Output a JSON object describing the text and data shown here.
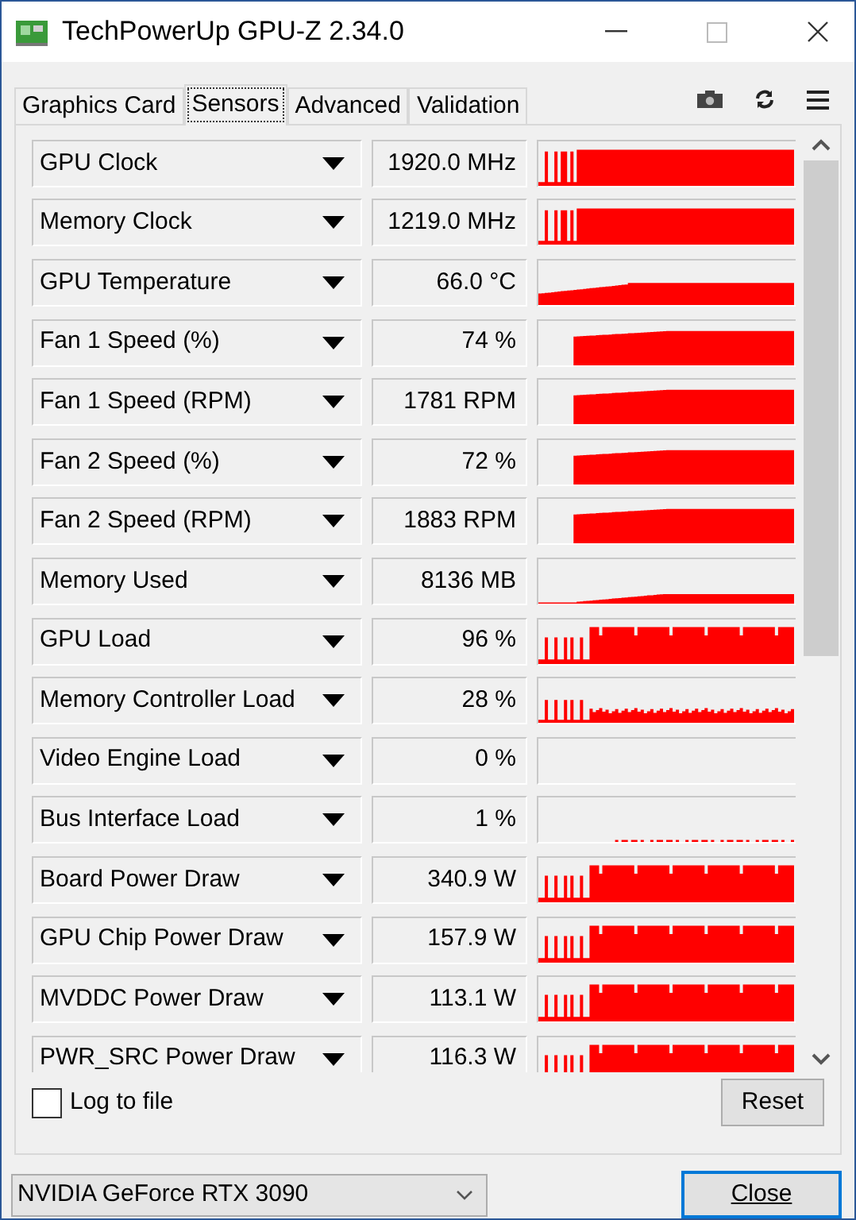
{
  "window": {
    "title": "TechPowerUp GPU-Z 2.34.0"
  },
  "tabs": [
    {
      "label": "Graphics Card",
      "selected": false
    },
    {
      "label": "Sensors",
      "selected": true
    },
    {
      "label": "Advanced",
      "selected": false
    },
    {
      "label": "Validation",
      "selected": false
    }
  ],
  "sensors": [
    {
      "name": "GPU Clock",
      "value": "1920.0 MHz",
      "kind": "spiky"
    },
    {
      "name": "Memory Clock",
      "value": "1219.0 MHz",
      "kind": "spiky"
    },
    {
      "name": "GPU Temperature",
      "value": "66.0 °C",
      "kind": "rise"
    },
    {
      "name": "Fan 1 Speed (%)",
      "value": "74 %",
      "kind": "ramp"
    },
    {
      "name": "Fan 1 Speed (RPM)",
      "value": "1781 RPM",
      "kind": "ramp"
    },
    {
      "name": "Fan 2 Speed (%)",
      "value": "72 %",
      "kind": "ramp"
    },
    {
      "name": "Fan 2 Speed (RPM)",
      "value": "1883 RPM",
      "kind": "ramp"
    },
    {
      "name": "Memory Used",
      "value": "8136 MB",
      "kind": "low"
    },
    {
      "name": "GPU Load",
      "value": "96 %",
      "kind": "load"
    },
    {
      "name": "Memory Controller Load",
      "value": "28 %",
      "kind": "lowload"
    },
    {
      "name": "Video Engine Load",
      "value": "0 %",
      "kind": "flat"
    },
    {
      "name": "Bus Interface Load",
      "value": "1 %",
      "kind": "blips"
    },
    {
      "name": "Board Power Draw",
      "value": "340.9 W",
      "kind": "load"
    },
    {
      "name": "GPU Chip Power Draw",
      "value": "157.9 W",
      "kind": "load"
    },
    {
      "name": "MVDDC Power Draw",
      "value": "113.1 W",
      "kind": "load"
    },
    {
      "name": "PWR_SRC Power Draw",
      "value": "116.3 W",
      "kind": "load"
    }
  ],
  "log_to_file": {
    "label": "Log to file",
    "checked": false
  },
  "reset_button": "Reset",
  "gpu_select": {
    "value": "NVIDIA GeForce RTX 3090"
  },
  "close_button": "Close"
}
